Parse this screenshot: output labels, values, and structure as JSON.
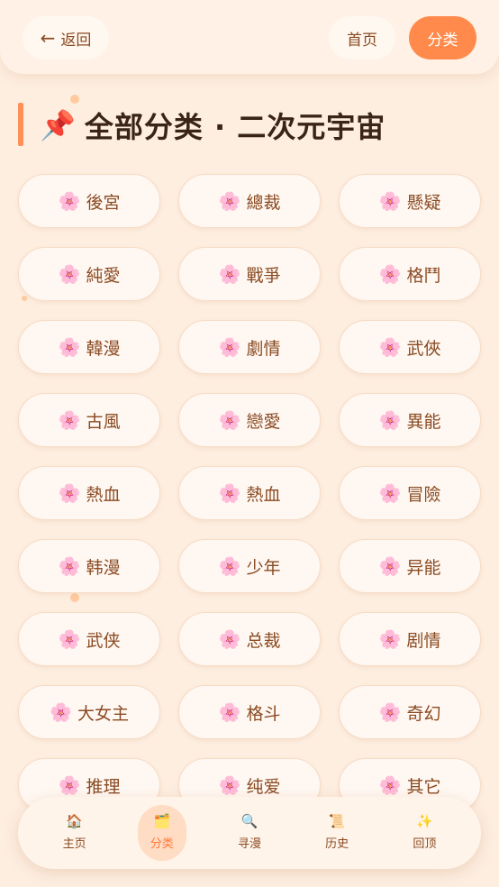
{
  "header": {
    "back_arrow": "←",
    "back_label": "返回",
    "home_label": "首页",
    "category_label": "分类"
  },
  "page": {
    "pin_icon": "📌",
    "title": "全部分类 · 二次元宇宙"
  },
  "chip_icon": "🌸",
  "categories": [
    "後宮",
    "總裁",
    "懸疑",
    "純愛",
    "戰爭",
    "格鬥",
    "韓漫",
    "劇情",
    "武俠",
    "古風",
    "戀愛",
    "異能",
    "熱血",
    "熱血",
    "冒險",
    "韩漫",
    "少年",
    "异能",
    "武侠",
    "总裁",
    "剧情",
    "大女主",
    "格斗",
    "奇幻",
    "推理",
    "纯爱",
    "其它"
  ],
  "bottom_nav": [
    {
      "icon": "🏠",
      "label": "主页",
      "active": false
    },
    {
      "icon": "🗂️",
      "label": "分类",
      "active": true
    },
    {
      "icon": "🔍",
      "label": "寻漫",
      "active": false
    },
    {
      "icon": "📜",
      "label": "历史",
      "active": false
    },
    {
      "icon": "✨",
      "label": "回顶",
      "active": false
    }
  ],
  "colors": {
    "background": "#fdeee0",
    "accent": "#ff8a4c",
    "chip_text": "#8a4a22"
  }
}
